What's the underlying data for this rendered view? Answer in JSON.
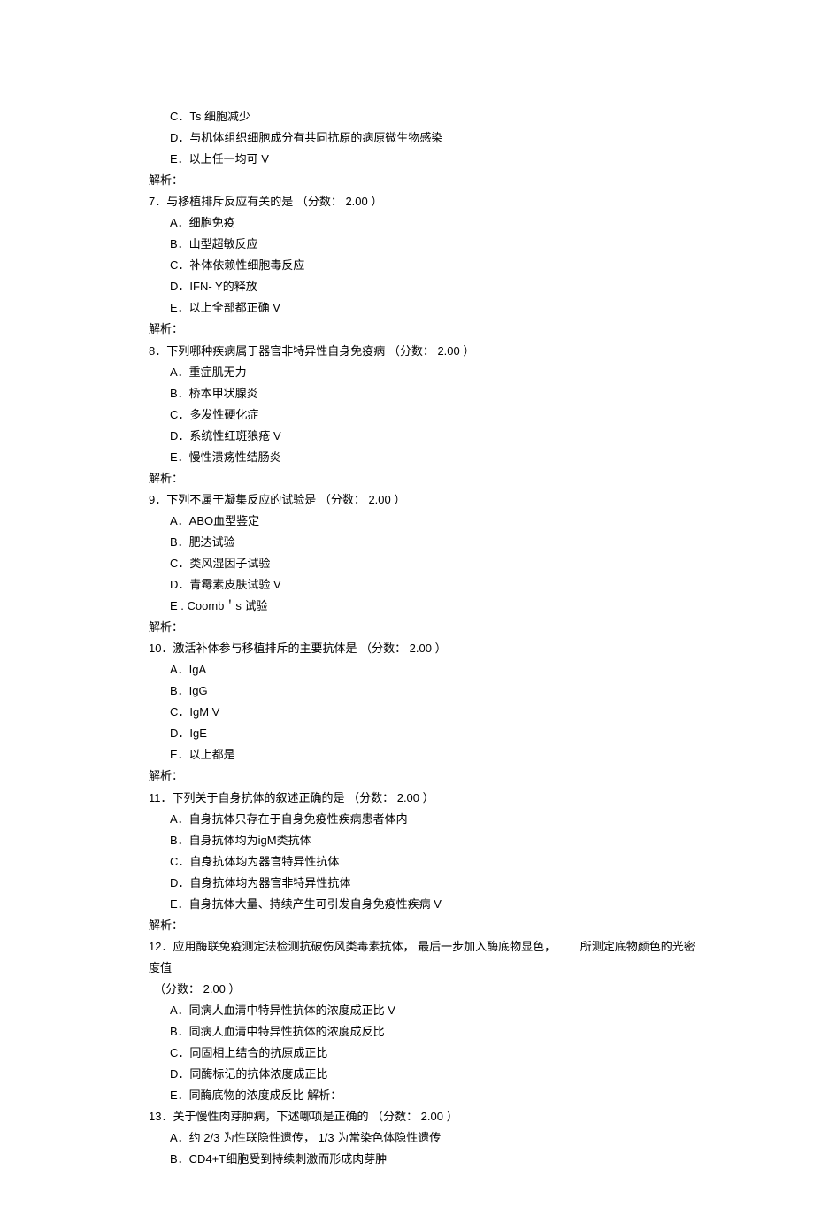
{
  "q6": {
    "optC": "C．Ts 细胞减少",
    "optD": "D．与机体组织细胞成分有共同抗原的病原微生物感染",
    "optE": "E．以上任一均可   V",
    "analysis": "解析："
  },
  "q7": {
    "stem": "7．与移植排斥反应有关的是  （分数：  2.00 ）",
    "optA": "A．细胞免疫",
    "optB": "B．山型超敏反应",
    "optC": "C．补体依赖性细胞毒反应",
    "optD": "D．IFN- Y的释放",
    "optE": "E．以上全部都正确  V",
    "analysis": "解析："
  },
  "q8": {
    "stem": "8．下列哪种疾病属于器官非特异性自身免疫病  （分数：  2.00 ）",
    "optA": "A．重症肌无力",
    "optB": "B．桥本甲状腺炎",
    "optC": "C．多发性硬化症",
    "optD": "D．系统性红斑狼疮  V",
    "optE": "E．慢性溃疡性结肠炎",
    "analysis": "解析："
  },
  "q9": {
    "stem": "9．下列不属于凝集反应的试验是  （分数：  2.00 ）",
    "optA": "A．ABO血型鉴定",
    "optB": "B．肥达试验",
    "optC": "C．类风湿因子试验",
    "optD": "D．青霉素皮肤试验  V",
    "optE": "E . Coomb＇s 试验",
    "analysis": "解析："
  },
  "q10": {
    "stem": "10．激活补体参与移植排斥的主要抗体是  （分数：  2.00 ）",
    "optA": "A．IgA",
    "optB": "B．IgG",
    "optC": "C．IgM V",
    "optD": "D．IgE",
    "optE": "E．以上都是",
    "analysis": "解析："
  },
  "q11": {
    "stem": "11．下列关于自身抗体的叙述正确的是  （分数：  2.00 ）",
    "optA": "A．自身抗体只存在于自身免疫性疾病患者体内",
    "optB": "B．自身抗体均为igM类抗体",
    "optC": "C．自身抗体均为器官特异性抗体",
    "optD": "D．自身抗体均为器官非特异性抗体",
    "optE": "E．自身抗体大量、持续产生可引发自身免疫性疾病  V",
    "analysis": "解析："
  },
  "q12": {
    "stemLine1a": "12．应用酶联免疫测定法检测抗破伤风类毒素抗体，  最后一步加入酶底物显色，",
    "stemLine1b": "所测定底物颜色的光密度值",
    "stemLine2": "（分数：  2.00 ）",
    "optA": "A．同病人血清中特异性抗体的浓度成正比  V",
    "optB": "B．同病人血清中特异性抗体的浓度成反比",
    "optC": "C．同固相上结合的抗原成正比",
    "optD": "D．同酶标记的抗体浓度成正比",
    "optE": "E．同酶底物的浓度成反比   解析："
  },
  "q13": {
    "stem": "13．关于慢性肉芽肿病，下述哪项是正确的  （分数：  2.00 ）",
    "optA": "A．约  2/3 为性联隐性遗传，  1/3 为常染色体隐性遗传",
    "optB": "B．CD4+T细胞受到持续刺激而形成肉芽肿"
  }
}
